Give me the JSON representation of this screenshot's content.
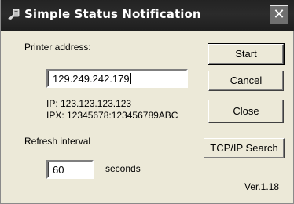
{
  "window": {
    "title": "Simple Status Notification",
    "close_glyph": "✕"
  },
  "printer": {
    "label": "Printer address:",
    "address_value": "129.249.242.179",
    "ip_line": "IP: 123.123.123.123",
    "ipx_line": "IPX: 12345678:123456789ABC"
  },
  "refresh": {
    "label": "Refresh interval",
    "interval_value": "60",
    "unit_label": "seconds"
  },
  "buttons": {
    "start": "Start",
    "cancel": "Cancel",
    "close": "Close",
    "tcpip_search": "TCP/IP Search"
  },
  "version": "Ver.1.18",
  "icons": {
    "title_icon": "printer-status-icon",
    "close_icon": "close-icon"
  }
}
